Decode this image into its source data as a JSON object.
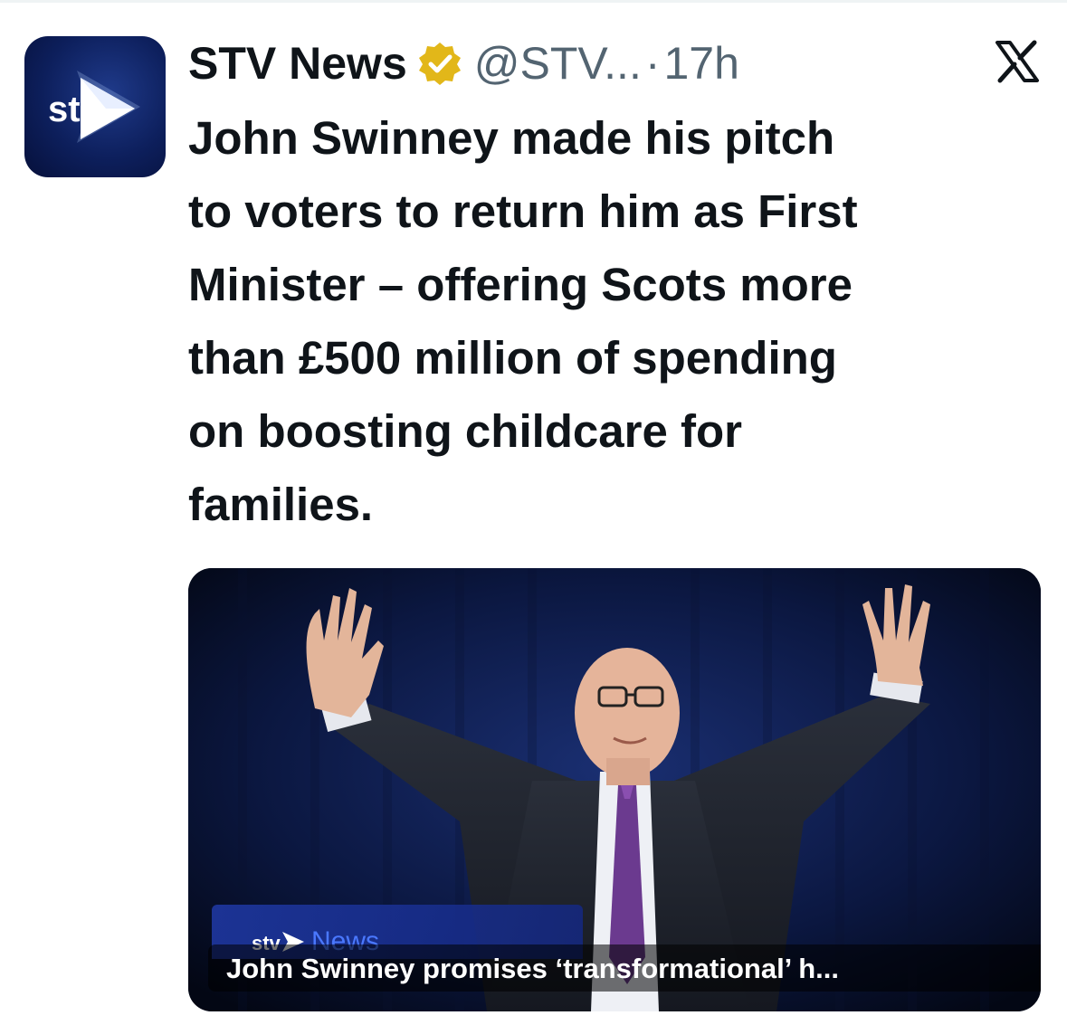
{
  "author": {
    "name": "STV News",
    "handle": "@STV...",
    "separator": "·",
    "time": "17h",
    "avatar_text": "stv",
    "verified_color": "#e2b719"
  },
  "platform": {
    "logo": "x-logo-icon"
  },
  "tweet": {
    "lines": [
      "John Swinney made his pitch",
      "to voters to return him as First",
      "Minister – offering Scots more",
      "than £500 million of spending",
      "on boosting childcare for",
      "families."
    ]
  },
  "media": {
    "brand_logo": "stv",
    "brand_word": "News",
    "card_title": "John Swinney promises ‘transformational’ h..."
  }
}
